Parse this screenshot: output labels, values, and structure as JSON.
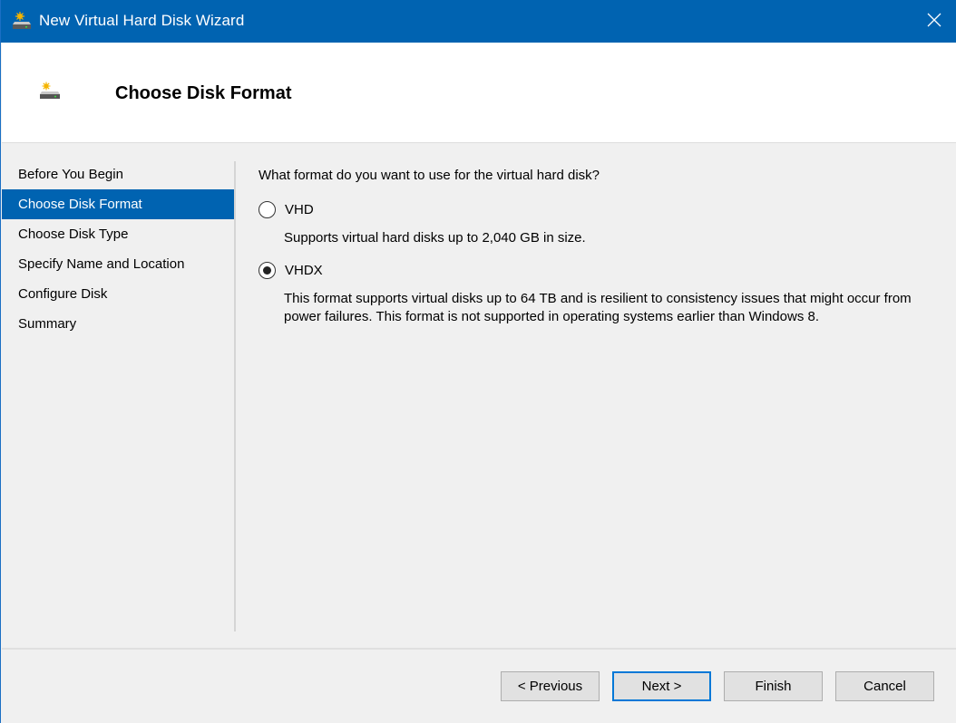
{
  "window": {
    "title": "New Virtual Hard Disk Wizard",
    "title_icon": "virtual-disk-wizard-icon",
    "close_icon": "close-icon",
    "accent_color": "#0063b1"
  },
  "header": {
    "icon": "new-disk-icon",
    "title": "Choose Disk Format"
  },
  "nav": {
    "items": [
      {
        "label": "Before You Begin",
        "active": false
      },
      {
        "label": "Choose Disk Format",
        "active": true
      },
      {
        "label": "Choose Disk Type",
        "active": false
      },
      {
        "label": "Specify Name and Location",
        "active": false
      },
      {
        "label": "Configure Disk",
        "active": false
      },
      {
        "label": "Summary",
        "active": false
      }
    ]
  },
  "content": {
    "question": "What format do you want to use for the virtual hard disk?",
    "options": [
      {
        "label": "VHD",
        "selected": false,
        "description": "Supports virtual hard disks up to 2,040 GB in size."
      },
      {
        "label": "VHDX",
        "selected": true,
        "description": "This format supports virtual disks up to 64 TB and is resilient to consistency issues that might occur from power failures. This format is not supported in operating systems earlier than Windows 8."
      }
    ]
  },
  "footer": {
    "previous_label": "< Previous",
    "next_label": "Next >",
    "finish_label": "Finish",
    "cancel_label": "Cancel"
  }
}
